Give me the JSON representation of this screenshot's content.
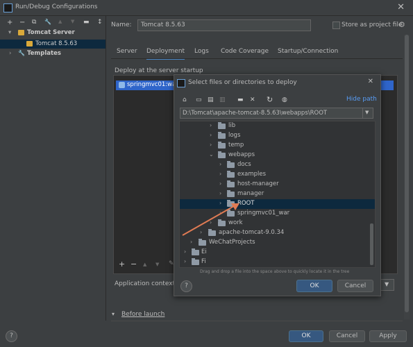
{
  "window": {
    "title": "Run/Debug Configurations",
    "close_glyph": "✕"
  },
  "left_toolbar": {
    "add": "+",
    "remove": "−",
    "copy": "⧉",
    "wrench": "🔧",
    "up": "▲",
    "down": "▼",
    "folder": "▬",
    "sort": "↕"
  },
  "tree": {
    "items": [
      {
        "label": "Tomcat Server",
        "chevron": "▾"
      },
      {
        "label": "Tomcat 8.5.63"
      },
      {
        "label": "Templates",
        "chevron": "›"
      }
    ]
  },
  "config": {
    "name_label": "Name:",
    "name_value": "Tomcat 8.5.63",
    "store_label": "Store as project file",
    "gear": "⚙"
  },
  "tabs": [
    "Server",
    "Deployment",
    "Logs",
    "Code Coverage",
    "Startup/Connection"
  ],
  "deployment": {
    "heading": "Deploy at the server startup",
    "artifact": "springmvc01:war",
    "tools": {
      "add": "+",
      "remove": "−",
      "up": "▲",
      "down": "▼",
      "edit": "✎"
    },
    "app_context_label": "Application context:"
  },
  "before_launch": {
    "label": "Before launch",
    "chevron": "▾"
  },
  "footer": {
    "help": "?",
    "ok": "OK",
    "cancel": "Cancel",
    "apply": "Apply"
  },
  "dialog": {
    "title": "Select files or directories to deploy",
    "close_glyph": "✕",
    "hide_path": "Hide path",
    "path_value": "D:\\Tomcat\\apache-tomcat-8.5.63\\webapps\\ROOT",
    "hint": "Drag and drop a file into the space above to quickly locate it in the tree",
    "help": "?",
    "ok": "OK",
    "cancel": "Cancel",
    "toolbar": {
      "home": "⌂",
      "desktop": "▭",
      "project": "▤",
      "module": "▥",
      "new_folder": "▬",
      "delete": "✕",
      "refresh": "↻",
      "show_hidden": "◍"
    },
    "files": [
      {
        "name": "lib",
        "chevron": "›"
      },
      {
        "name": "logs",
        "chevron": "›"
      },
      {
        "name": "temp",
        "chevron": "›"
      },
      {
        "name": "webapps",
        "chevron": "⌄"
      },
      {
        "name": "docs",
        "chevron": "›"
      },
      {
        "name": "examples",
        "chevron": "›"
      },
      {
        "name": "host-manager",
        "chevron": "›"
      },
      {
        "name": "manager",
        "chevron": "›"
      },
      {
        "name": "ROOT",
        "chevron": "›"
      },
      {
        "name": "springmvc01_war",
        "chevron": "›"
      },
      {
        "name": "work",
        "chevron": "›"
      },
      {
        "name": "apache-tomcat-9.0.34",
        "chevron": "›"
      },
      {
        "name": "WeChatProjects",
        "chevron": "›"
      },
      {
        "name": "Ei",
        "chevron": "›"
      },
      {
        "name": "Fi",
        "chevron": "›"
      }
    ]
  },
  "colors": {
    "accent": "#4a88c7",
    "selection": "#0d293e",
    "annotation_arrow": "#e07b54"
  }
}
